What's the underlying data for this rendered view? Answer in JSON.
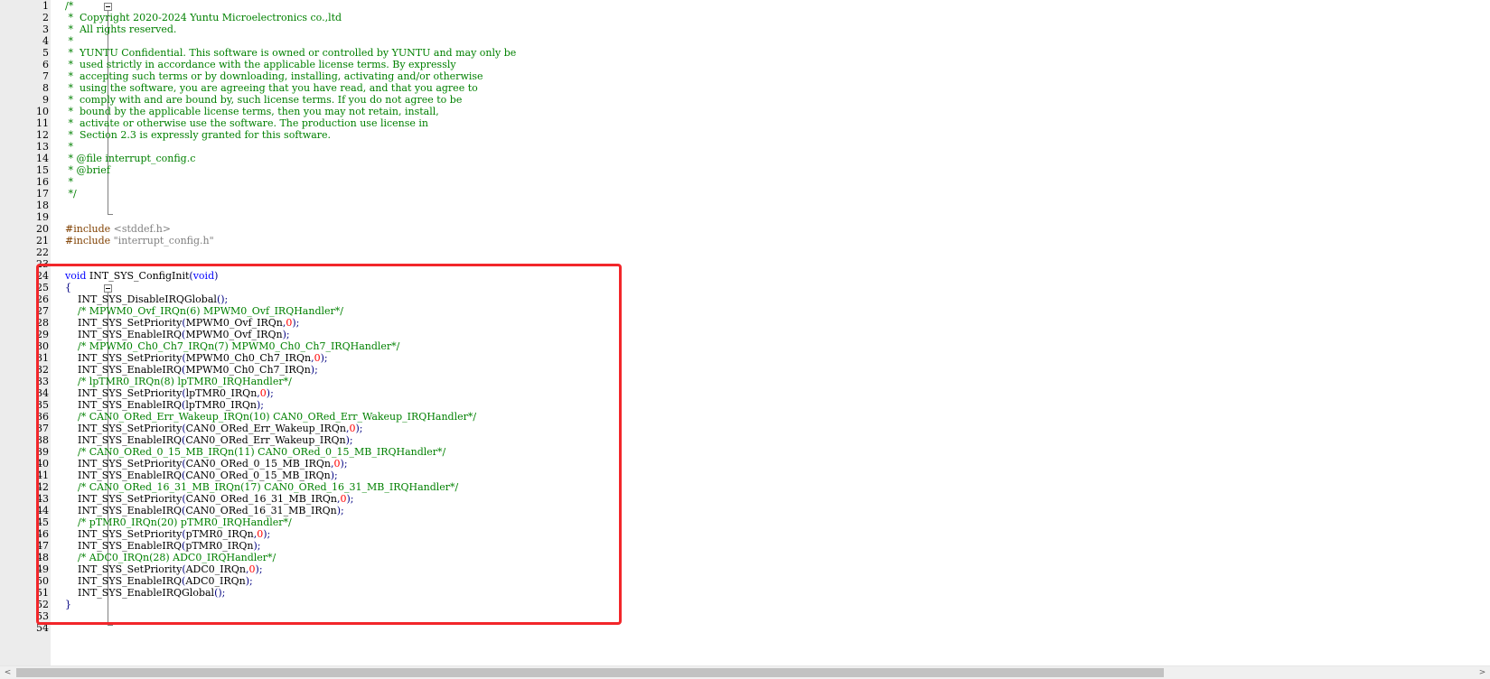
{
  "editor": {
    "lines": [
      {
        "n": "1",
        "tokens": [
          [
            "comment",
            "/*"
          ]
        ]
      },
      {
        "n": "2",
        "tokens": [
          [
            "comment",
            " *  Copyright 2020-2024 Yuntu Microelectronics co.,ltd"
          ]
        ]
      },
      {
        "n": "3",
        "tokens": [
          [
            "comment",
            " *  All rights reserved."
          ]
        ]
      },
      {
        "n": "4",
        "tokens": [
          [
            "comment",
            " *"
          ]
        ]
      },
      {
        "n": "5",
        "tokens": [
          [
            "comment",
            " *  YUNTU Confidential. This software is owned or controlled by YUNTU and may only be"
          ]
        ]
      },
      {
        "n": "6",
        "tokens": [
          [
            "comment",
            " *  used strictly in accordance with the applicable license terms. By expressly"
          ]
        ]
      },
      {
        "n": "7",
        "tokens": [
          [
            "comment",
            " *  accepting such terms or by downloading, installing, activating and/or otherwise"
          ]
        ]
      },
      {
        "n": "8",
        "tokens": [
          [
            "comment",
            " *  using the software, you are agreeing that you have read, and that you agree to"
          ]
        ]
      },
      {
        "n": "9",
        "tokens": [
          [
            "comment",
            " *  comply with and are bound by, such license terms. If you do not agree to be"
          ]
        ]
      },
      {
        "n": "10",
        "tokens": [
          [
            "comment",
            " *  bound by the applicable license terms, then you may not retain, install,"
          ]
        ]
      },
      {
        "n": "11",
        "tokens": [
          [
            "comment",
            " *  activate or otherwise use the software. The production use license in"
          ]
        ]
      },
      {
        "n": "12",
        "tokens": [
          [
            "comment",
            " *  Section 2.3 is expressly granted for this software."
          ]
        ]
      },
      {
        "n": "13",
        "tokens": [
          [
            "comment",
            " *"
          ]
        ]
      },
      {
        "n": "14",
        "tokens": [
          [
            "comment",
            " * @file interrupt_config.c"
          ]
        ]
      },
      {
        "n": "15",
        "tokens": [
          [
            "comment",
            " * @brief"
          ]
        ]
      },
      {
        "n": "16",
        "tokens": [
          [
            "comment",
            " *"
          ]
        ]
      },
      {
        "n": "17",
        "tokens": [
          [
            "comment",
            " */"
          ]
        ]
      },
      {
        "n": "18",
        "tokens": []
      },
      {
        "n": "19",
        "tokens": []
      },
      {
        "n": "20",
        "tokens": [
          [
            "preproc",
            "#include "
          ],
          [
            "string",
            "<stddef.h>"
          ]
        ]
      },
      {
        "n": "21",
        "tokens": [
          [
            "preproc",
            "#include "
          ],
          [
            "string",
            "\"interrupt_config.h\""
          ]
        ]
      },
      {
        "n": "22",
        "tokens": []
      },
      {
        "n": "23",
        "tokens": []
      },
      {
        "n": "24",
        "tokens": [
          [
            "keyword",
            "void"
          ],
          [
            "plain",
            " INT_SYS_ConfigInit"
          ],
          [
            "op",
            "("
          ],
          [
            "keyword",
            "void"
          ],
          [
            "op",
            ")"
          ]
        ]
      },
      {
        "n": "25",
        "tokens": [
          [
            "op",
            "{"
          ]
        ]
      },
      {
        "n": "26",
        "tokens": [
          [
            "plain",
            "    INT_SYS_DisableIRQGlobal"
          ],
          [
            "op",
            "();"
          ]
        ]
      },
      {
        "n": "27",
        "tokens": [
          [
            "comment",
            "    /* MPWM0_Ovf_IRQn(6) MPWM0_Ovf_IRQHandler*/"
          ]
        ]
      },
      {
        "n": "28",
        "tokens": [
          [
            "plain",
            "    INT_SYS_SetPriority"
          ],
          [
            "op",
            "("
          ],
          [
            "plain",
            "MPWM0_Ovf_IRQn"
          ],
          [
            "op",
            ","
          ],
          [
            "number",
            "0"
          ],
          [
            "op",
            ");"
          ]
        ]
      },
      {
        "n": "29",
        "tokens": [
          [
            "plain",
            "    INT_SYS_EnableIRQ"
          ],
          [
            "op",
            "("
          ],
          [
            "plain",
            "MPWM0_Ovf_IRQn"
          ],
          [
            "op",
            ");"
          ]
        ]
      },
      {
        "n": "30",
        "tokens": [
          [
            "comment",
            "    /* MPWM0_Ch0_Ch7_IRQn(7) MPWM0_Ch0_Ch7_IRQHandler*/"
          ]
        ]
      },
      {
        "n": "31",
        "tokens": [
          [
            "plain",
            "    INT_SYS_SetPriority"
          ],
          [
            "op",
            "("
          ],
          [
            "plain",
            "MPWM0_Ch0_Ch7_IRQn"
          ],
          [
            "op",
            ","
          ],
          [
            "number",
            "0"
          ],
          [
            "op",
            ");"
          ]
        ]
      },
      {
        "n": "32",
        "tokens": [
          [
            "plain",
            "    INT_SYS_EnableIRQ"
          ],
          [
            "op",
            "("
          ],
          [
            "plain",
            "MPWM0_Ch0_Ch7_IRQn"
          ],
          [
            "op",
            ");"
          ]
        ]
      },
      {
        "n": "33",
        "tokens": [
          [
            "comment",
            "    /* lpTMR0_IRQn(8) lpTMR0_IRQHandler*/"
          ]
        ]
      },
      {
        "n": "34",
        "tokens": [
          [
            "plain",
            "    INT_SYS_SetPriority"
          ],
          [
            "op",
            "("
          ],
          [
            "plain",
            "lpTMR0_IRQn"
          ],
          [
            "op",
            ","
          ],
          [
            "number",
            "0"
          ],
          [
            "op",
            ");"
          ]
        ]
      },
      {
        "n": "35",
        "tokens": [
          [
            "plain",
            "    INT_SYS_EnableIRQ"
          ],
          [
            "op",
            "("
          ],
          [
            "plain",
            "lpTMR0_IRQn"
          ],
          [
            "op",
            ");"
          ]
        ]
      },
      {
        "n": "36",
        "tokens": [
          [
            "comment",
            "    /* CAN0_ORed_Err_Wakeup_IRQn(10) CAN0_ORed_Err_Wakeup_IRQHandler*/"
          ]
        ]
      },
      {
        "n": "37",
        "tokens": [
          [
            "plain",
            "    INT_SYS_SetPriority"
          ],
          [
            "op",
            "("
          ],
          [
            "plain",
            "CAN0_ORed_Err_Wakeup_IRQn"
          ],
          [
            "op",
            ","
          ],
          [
            "number",
            "0"
          ],
          [
            "op",
            ");"
          ]
        ]
      },
      {
        "n": "38",
        "tokens": [
          [
            "plain",
            "    INT_SYS_EnableIRQ"
          ],
          [
            "op",
            "("
          ],
          [
            "plain",
            "CAN0_ORed_Err_Wakeup_IRQn"
          ],
          [
            "op",
            ");"
          ]
        ]
      },
      {
        "n": "39",
        "tokens": [
          [
            "comment",
            "    /* CAN0_ORed_0_15_MB_IRQn(11) CAN0_ORed_0_15_MB_IRQHandler*/"
          ]
        ]
      },
      {
        "n": "40",
        "tokens": [
          [
            "plain",
            "    INT_SYS_SetPriority"
          ],
          [
            "op",
            "("
          ],
          [
            "plain",
            "CAN0_ORed_0_15_MB_IRQn"
          ],
          [
            "op",
            ","
          ],
          [
            "number",
            "0"
          ],
          [
            "op",
            ");"
          ]
        ]
      },
      {
        "n": "41",
        "tokens": [
          [
            "plain",
            "    INT_SYS_EnableIRQ"
          ],
          [
            "op",
            "("
          ],
          [
            "plain",
            "CAN0_ORed_0_15_MB_IRQn"
          ],
          [
            "op",
            ");"
          ]
        ]
      },
      {
        "n": "42",
        "tokens": [
          [
            "comment",
            "    /* CAN0_ORed_16_31_MB_IRQn(17) CAN0_ORed_16_31_MB_IRQHandler*/"
          ]
        ]
      },
      {
        "n": "43",
        "tokens": [
          [
            "plain",
            "    INT_SYS_SetPriority"
          ],
          [
            "op",
            "("
          ],
          [
            "plain",
            "CAN0_ORed_16_31_MB_IRQn"
          ],
          [
            "op",
            ","
          ],
          [
            "number",
            "0"
          ],
          [
            "op",
            ");"
          ]
        ]
      },
      {
        "n": "44",
        "tokens": [
          [
            "plain",
            "    INT_SYS_EnableIRQ"
          ],
          [
            "op",
            "("
          ],
          [
            "plain",
            "CAN0_ORed_16_31_MB_IRQn"
          ],
          [
            "op",
            ");"
          ]
        ]
      },
      {
        "n": "45",
        "tokens": [
          [
            "comment",
            "    /* pTMR0_IRQn(20) pTMR0_IRQHandler*/"
          ]
        ]
      },
      {
        "n": "46",
        "tokens": [
          [
            "plain",
            "    INT_SYS_SetPriority"
          ],
          [
            "op",
            "("
          ],
          [
            "plain",
            "pTMR0_IRQn"
          ],
          [
            "op",
            ","
          ],
          [
            "number",
            "0"
          ],
          [
            "op",
            ");"
          ]
        ]
      },
      {
        "n": "47",
        "tokens": [
          [
            "plain",
            "    INT_SYS_EnableIRQ"
          ],
          [
            "op",
            "("
          ],
          [
            "plain",
            "pTMR0_IRQn"
          ],
          [
            "op",
            ");"
          ]
        ]
      },
      {
        "n": "48",
        "tokens": [
          [
            "comment",
            "    /* ADC0_IRQn(28) ADC0_IRQHandler*/"
          ]
        ]
      },
      {
        "n": "49",
        "tokens": [
          [
            "plain",
            "    INT_SYS_SetPriority"
          ],
          [
            "op",
            "("
          ],
          [
            "plain",
            "ADC0_IRQn"
          ],
          [
            "op",
            ","
          ],
          [
            "number",
            "0"
          ],
          [
            "op",
            ");"
          ]
        ]
      },
      {
        "n": "50",
        "tokens": [
          [
            "plain",
            "    INT_SYS_EnableIRQ"
          ],
          [
            "op",
            "("
          ],
          [
            "plain",
            "ADC0_IRQn"
          ],
          [
            "op",
            ");"
          ]
        ]
      },
      {
        "n": "51",
        "tokens": [
          [
            "plain",
            "    INT_SYS_EnableIRQGlobal"
          ],
          [
            "op",
            "();"
          ]
        ]
      },
      {
        "n": "52",
        "tokens": [
          [
            "op",
            "}"
          ]
        ]
      },
      {
        "n": "53",
        "tokens": []
      },
      {
        "n": "54",
        "tokens": []
      }
    ],
    "highlight_color": "#f2262a"
  },
  "scrollbar": {
    "left_arrow_icon": "chevron-left-icon",
    "right_arrow_icon": "chevron-right-icon",
    "left_glyph": "<",
    "right_glyph": ">"
  }
}
